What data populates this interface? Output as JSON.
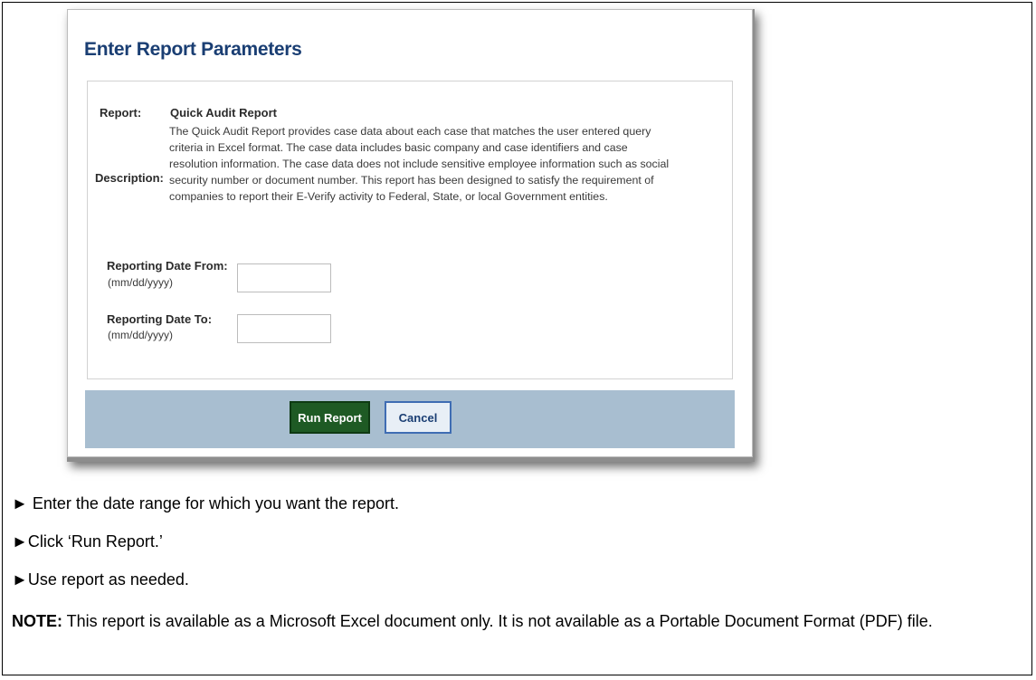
{
  "dialog": {
    "title": "Enter Report Parameters",
    "report_label": "Report:",
    "report_name": "Quick Audit Report",
    "description_label": "Description:",
    "description_lines": [
      "The Quick Audit Report provides case data about each case that matches the user entered query",
      "criteria in Excel format. The case data includes basic company and case identifiers and case",
      "resolution information. The case data does not include sensitive employee information such as social",
      "security number or document number. This report has been designed to satisfy the requirement of",
      "companies to report their E-Verify activity to Federal, State, or local Government entities."
    ],
    "date_from_label": "Reporting Date From:",
    "date_from_hint": "(mm/dd/yyyy)",
    "date_from_value": "",
    "date_to_label": "Reporting Date To:",
    "date_to_hint": "(mm/dd/yyyy)",
    "date_to_value": "",
    "run_button": "Run Report",
    "cancel_button": "Cancel"
  },
  "instructions": {
    "steps": [
      "► Enter the date range for which you want the report.",
      "►Click ‘Run Report.’",
      "►Use report as needed."
    ],
    "note_label": "NOTE:",
    "note_text": " This report is available as a Microsoft Excel document only. It is not available as a Portable Document Format (PDF) file."
  },
  "colors": {
    "title": "#1a3e73",
    "button_bar": "#a8bed0",
    "run_button": "#1e5a24",
    "cancel_border": "#3f6db3"
  }
}
